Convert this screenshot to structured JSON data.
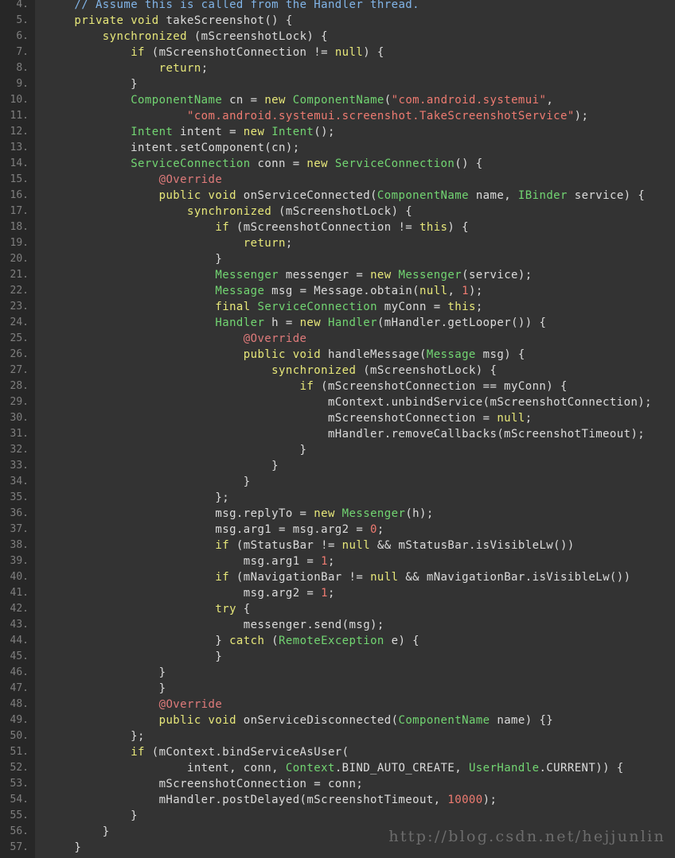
{
  "editor": {
    "background": "#333333",
    "gutter_background": "#272727",
    "gutter_text_color": "#7f7f7f",
    "default_text_color": "#dcdcdc",
    "first_line_number": 4,
    "last_line_number": 57,
    "line_height_px": 20,
    "language": "java"
  },
  "palette": {
    "keyword": "#e8e87a",
    "type": "#72d572",
    "string": "#ee7b71",
    "number": "#ee7b71",
    "comment": "#82b5e8",
    "annotation": "#e07b7b",
    "plain": "#dcdcdc"
  },
  "watermark": {
    "text": "http://blog.csdn.net/hejjunlin",
    "color": "#6d6d6d"
  },
  "lines": [
    {
      "n": "4.",
      "tokens": [
        {
          "t": "    ",
          "c": "plain"
        },
        {
          "t": "// Assume this is called from the Handler thread.",
          "c": "cmt"
        }
      ]
    },
    {
      "n": "5.",
      "tokens": [
        {
          "t": "    ",
          "c": "plain"
        },
        {
          "t": "private void",
          "c": "kw"
        },
        {
          "t": " takeScreenshot() {",
          "c": "plain"
        }
      ]
    },
    {
      "n": "6.",
      "tokens": [
        {
          "t": "        ",
          "c": "plain"
        },
        {
          "t": "synchronized",
          "c": "kw"
        },
        {
          "t": " (mScreenshotLock) {",
          "c": "plain"
        }
      ]
    },
    {
      "n": "7.",
      "tokens": [
        {
          "t": "            ",
          "c": "plain"
        },
        {
          "t": "if",
          "c": "kw"
        },
        {
          "t": " (mScreenshotConnection != ",
          "c": "plain"
        },
        {
          "t": "null",
          "c": "kw"
        },
        {
          "t": ") {",
          "c": "plain"
        }
      ]
    },
    {
      "n": "8.",
      "tokens": [
        {
          "t": "                ",
          "c": "plain"
        },
        {
          "t": "return",
          "c": "kw"
        },
        {
          "t": ";",
          "c": "plain"
        }
      ]
    },
    {
      "n": "9.",
      "tokens": [
        {
          "t": "            }",
          "c": "plain"
        }
      ]
    },
    {
      "n": "10.",
      "tokens": [
        {
          "t": "            ",
          "c": "plain"
        },
        {
          "t": "ComponentName",
          "c": "type"
        },
        {
          "t": " cn = ",
          "c": "plain"
        },
        {
          "t": "new",
          "c": "kw"
        },
        {
          "t": " ",
          "c": "plain"
        },
        {
          "t": "ComponentName",
          "c": "type"
        },
        {
          "t": "(",
          "c": "plain"
        },
        {
          "t": "\"com.android.systemui\"",
          "c": "str"
        },
        {
          "t": ",",
          "c": "plain"
        }
      ]
    },
    {
      "n": "11.",
      "tokens": [
        {
          "t": "                    ",
          "c": "plain"
        },
        {
          "t": "\"com.android.systemui.screenshot.TakeScreenshotService\"",
          "c": "str"
        },
        {
          "t": ");",
          "c": "plain"
        }
      ]
    },
    {
      "n": "12.",
      "tokens": [
        {
          "t": "            ",
          "c": "plain"
        },
        {
          "t": "Intent",
          "c": "type"
        },
        {
          "t": " intent = ",
          "c": "plain"
        },
        {
          "t": "new",
          "c": "kw"
        },
        {
          "t": " ",
          "c": "plain"
        },
        {
          "t": "Intent",
          "c": "type"
        },
        {
          "t": "();",
          "c": "plain"
        }
      ]
    },
    {
      "n": "13.",
      "tokens": [
        {
          "t": "            intent.setComponent(cn);",
          "c": "plain"
        }
      ]
    },
    {
      "n": "14.",
      "tokens": [
        {
          "t": "            ",
          "c": "plain"
        },
        {
          "t": "ServiceConnection",
          "c": "type"
        },
        {
          "t": " conn = ",
          "c": "plain"
        },
        {
          "t": "new",
          "c": "kw"
        },
        {
          "t": " ",
          "c": "plain"
        },
        {
          "t": "ServiceConnection",
          "c": "type"
        },
        {
          "t": "() {",
          "c": "plain"
        }
      ]
    },
    {
      "n": "15.",
      "tokens": [
        {
          "t": "                ",
          "c": "plain"
        },
        {
          "t": "@Override",
          "c": "anno"
        }
      ]
    },
    {
      "n": "16.",
      "tokens": [
        {
          "t": "                ",
          "c": "plain"
        },
        {
          "t": "public void",
          "c": "kw"
        },
        {
          "t": " onServiceConnected(",
          "c": "plain"
        },
        {
          "t": "ComponentName",
          "c": "type"
        },
        {
          "t": " name, ",
          "c": "plain"
        },
        {
          "t": "IBinder",
          "c": "type"
        },
        {
          "t": " service) {",
          "c": "plain"
        }
      ]
    },
    {
      "n": "17.",
      "tokens": [
        {
          "t": "                    ",
          "c": "plain"
        },
        {
          "t": "synchronized",
          "c": "kw"
        },
        {
          "t": " (mScreenshotLock) {",
          "c": "plain"
        }
      ]
    },
    {
      "n": "18.",
      "tokens": [
        {
          "t": "                        ",
          "c": "plain"
        },
        {
          "t": "if",
          "c": "kw"
        },
        {
          "t": " (mScreenshotConnection != ",
          "c": "plain"
        },
        {
          "t": "this",
          "c": "kw"
        },
        {
          "t": ") {",
          "c": "plain"
        }
      ]
    },
    {
      "n": "19.",
      "tokens": [
        {
          "t": "                            ",
          "c": "plain"
        },
        {
          "t": "return",
          "c": "kw"
        },
        {
          "t": ";",
          "c": "plain"
        }
      ]
    },
    {
      "n": "20.",
      "tokens": [
        {
          "t": "                        }",
          "c": "plain"
        }
      ]
    },
    {
      "n": "21.",
      "tokens": [
        {
          "t": "                        ",
          "c": "plain"
        },
        {
          "t": "Messenger",
          "c": "type"
        },
        {
          "t": " messenger = ",
          "c": "plain"
        },
        {
          "t": "new",
          "c": "kw"
        },
        {
          "t": " ",
          "c": "plain"
        },
        {
          "t": "Messenger",
          "c": "type"
        },
        {
          "t": "(service);",
          "c": "plain"
        }
      ]
    },
    {
      "n": "22.",
      "tokens": [
        {
          "t": "                        ",
          "c": "plain"
        },
        {
          "t": "Message",
          "c": "type"
        },
        {
          "t": " msg = ",
          "c": "plain"
        },
        {
          "t": "Message",
          "c": "plain"
        },
        {
          "t": ".obtain(",
          "c": "plain"
        },
        {
          "t": "null",
          "c": "kw"
        },
        {
          "t": ", ",
          "c": "plain"
        },
        {
          "t": "1",
          "c": "num"
        },
        {
          "t": ");",
          "c": "plain"
        }
      ]
    },
    {
      "n": "23.",
      "tokens": [
        {
          "t": "                        ",
          "c": "plain"
        },
        {
          "t": "final",
          "c": "kw"
        },
        {
          "t": " ",
          "c": "plain"
        },
        {
          "t": "ServiceConnection",
          "c": "type"
        },
        {
          "t": " myConn = ",
          "c": "plain"
        },
        {
          "t": "this",
          "c": "kw"
        },
        {
          "t": ";",
          "c": "plain"
        }
      ]
    },
    {
      "n": "24.",
      "tokens": [
        {
          "t": "                        ",
          "c": "plain"
        },
        {
          "t": "Handler",
          "c": "type"
        },
        {
          "t": " h = ",
          "c": "plain"
        },
        {
          "t": "new",
          "c": "kw"
        },
        {
          "t": " ",
          "c": "plain"
        },
        {
          "t": "Handler",
          "c": "type"
        },
        {
          "t": "(mHandler.getLooper()) {",
          "c": "plain"
        }
      ]
    },
    {
      "n": "25.",
      "tokens": [
        {
          "t": "                            ",
          "c": "plain"
        },
        {
          "t": "@Override",
          "c": "anno"
        }
      ]
    },
    {
      "n": "26.",
      "tokens": [
        {
          "t": "                            ",
          "c": "plain"
        },
        {
          "t": "public void",
          "c": "kw"
        },
        {
          "t": " handleMessage(",
          "c": "plain"
        },
        {
          "t": "Message",
          "c": "type"
        },
        {
          "t": " msg) {",
          "c": "plain"
        }
      ]
    },
    {
      "n": "27.",
      "tokens": [
        {
          "t": "                                ",
          "c": "plain"
        },
        {
          "t": "synchronized",
          "c": "kw"
        },
        {
          "t": " (mScreenshotLock) {",
          "c": "plain"
        }
      ]
    },
    {
      "n": "28.",
      "tokens": [
        {
          "t": "                                    ",
          "c": "plain"
        },
        {
          "t": "if",
          "c": "kw"
        },
        {
          "t": " (mScreenshotConnection == myConn) {",
          "c": "plain"
        }
      ]
    },
    {
      "n": "29.",
      "tokens": [
        {
          "t": "                                        mContext.unbindService(mScreenshotConnection);",
          "c": "plain"
        }
      ]
    },
    {
      "n": "30.",
      "tokens": [
        {
          "t": "                                        mScreenshotConnection = ",
          "c": "plain"
        },
        {
          "t": "null",
          "c": "kw"
        },
        {
          "t": ";",
          "c": "plain"
        }
      ]
    },
    {
      "n": "31.",
      "tokens": [
        {
          "t": "                                        mHandler.removeCallbacks(mScreenshotTimeout);",
          "c": "plain"
        }
      ]
    },
    {
      "n": "32.",
      "tokens": [
        {
          "t": "                                    }",
          "c": "plain"
        }
      ]
    },
    {
      "n": "33.",
      "tokens": [
        {
          "t": "                                }",
          "c": "plain"
        }
      ]
    },
    {
      "n": "34.",
      "tokens": [
        {
          "t": "                            }",
          "c": "plain"
        }
      ]
    },
    {
      "n": "35.",
      "tokens": [
        {
          "t": "                        };",
          "c": "plain"
        }
      ]
    },
    {
      "n": "36.",
      "tokens": [
        {
          "t": "                        msg.replyTo = ",
          "c": "plain"
        },
        {
          "t": "new",
          "c": "kw"
        },
        {
          "t": " ",
          "c": "plain"
        },
        {
          "t": "Messenger",
          "c": "type"
        },
        {
          "t": "(h);",
          "c": "plain"
        }
      ]
    },
    {
      "n": "37.",
      "tokens": [
        {
          "t": "                        msg.arg1 = msg.arg2 = ",
          "c": "plain"
        },
        {
          "t": "0",
          "c": "num"
        },
        {
          "t": ";",
          "c": "plain"
        }
      ]
    },
    {
      "n": "38.",
      "tokens": [
        {
          "t": "                        ",
          "c": "plain"
        },
        {
          "t": "if",
          "c": "kw"
        },
        {
          "t": " (mStatusBar != ",
          "c": "plain"
        },
        {
          "t": "null",
          "c": "kw"
        },
        {
          "t": " && mStatusBar.isVisibleLw())",
          "c": "plain"
        }
      ]
    },
    {
      "n": "39.",
      "tokens": [
        {
          "t": "                            msg.arg1 = ",
          "c": "plain"
        },
        {
          "t": "1",
          "c": "num"
        },
        {
          "t": ";",
          "c": "plain"
        }
      ]
    },
    {
      "n": "40.",
      "tokens": [
        {
          "t": "                        ",
          "c": "plain"
        },
        {
          "t": "if",
          "c": "kw"
        },
        {
          "t": " (mNavigationBar != ",
          "c": "plain"
        },
        {
          "t": "null",
          "c": "kw"
        },
        {
          "t": " && mNavigationBar.isVisibleLw())",
          "c": "plain"
        }
      ]
    },
    {
      "n": "41.",
      "tokens": [
        {
          "t": "                            msg.arg2 = ",
          "c": "plain"
        },
        {
          "t": "1",
          "c": "num"
        },
        {
          "t": ";",
          "c": "plain"
        }
      ]
    },
    {
      "n": "42.",
      "tokens": [
        {
          "t": "                        ",
          "c": "plain"
        },
        {
          "t": "try",
          "c": "kw"
        },
        {
          "t": " {",
          "c": "plain"
        }
      ]
    },
    {
      "n": "43.",
      "tokens": [
        {
          "t": "                            messenger.send(msg);",
          "c": "plain"
        }
      ]
    },
    {
      "n": "44.",
      "tokens": [
        {
          "t": "                        } ",
          "c": "plain"
        },
        {
          "t": "catch",
          "c": "kw"
        },
        {
          "t": " (",
          "c": "plain"
        },
        {
          "t": "RemoteException",
          "c": "type"
        },
        {
          "t": " e) {",
          "c": "plain"
        }
      ]
    },
    {
      "n": "45.",
      "tokens": [
        {
          "t": "                        }",
          "c": "plain"
        }
      ]
    },
    {
      "n": "46.",
      "tokens": [
        {
          "t": "                }",
          "c": "plain"
        }
      ]
    },
    {
      "n": "47.",
      "tokens": [
        {
          "t": "                }",
          "c": "plain"
        }
      ]
    },
    {
      "n": "48.",
      "tokens": [
        {
          "t": "                ",
          "c": "plain"
        },
        {
          "t": "@Override",
          "c": "anno"
        }
      ]
    },
    {
      "n": "49.",
      "tokens": [
        {
          "t": "                ",
          "c": "plain"
        },
        {
          "t": "public void",
          "c": "kw"
        },
        {
          "t": " onServiceDisconnected(",
          "c": "plain"
        },
        {
          "t": "ComponentName",
          "c": "type"
        },
        {
          "t": " name) {}",
          "c": "plain"
        }
      ]
    },
    {
      "n": "50.",
      "tokens": [
        {
          "t": "            };",
          "c": "plain"
        }
      ]
    },
    {
      "n": "51.",
      "tokens": [
        {
          "t": "            ",
          "c": "plain"
        },
        {
          "t": "if",
          "c": "kw"
        },
        {
          "t": " (mContext.bindServiceAsUser(",
          "c": "plain"
        }
      ]
    },
    {
      "n": "52.",
      "tokens": [
        {
          "t": "                    intent, conn, ",
          "c": "plain"
        },
        {
          "t": "Context",
          "c": "type"
        },
        {
          "t": ".BIND_AUTO_CREATE, ",
          "c": "plain"
        },
        {
          "t": "UserHandle",
          "c": "type"
        },
        {
          "t": ".CURRENT)) {",
          "c": "plain"
        }
      ]
    },
    {
      "n": "53.",
      "tokens": [
        {
          "t": "                mScreenshotConnection = conn;",
          "c": "plain"
        }
      ]
    },
    {
      "n": "54.",
      "tokens": [
        {
          "t": "                mHandler.postDelayed(mScreenshotTimeout, ",
          "c": "plain"
        },
        {
          "t": "10000",
          "c": "num"
        },
        {
          "t": ");",
          "c": "plain"
        }
      ]
    },
    {
      "n": "55.",
      "tokens": [
        {
          "t": "            }",
          "c": "plain"
        }
      ]
    },
    {
      "n": "56.",
      "tokens": [
        {
          "t": "        }",
          "c": "plain"
        }
      ]
    },
    {
      "n": "57.",
      "tokens": [
        {
          "t": "    }",
          "c": "plain"
        }
      ]
    }
  ]
}
